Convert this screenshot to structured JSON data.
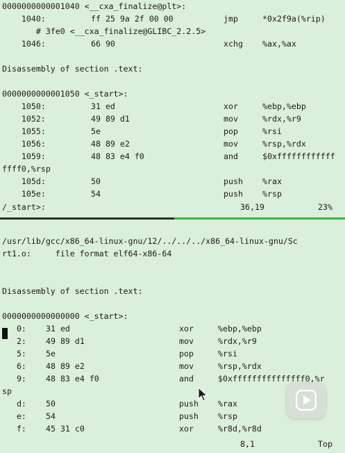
{
  "top_pane": {
    "lines": [
      {
        "segs": [
          "0000000000001040 <__cxa_finalize@plt>:"
        ]
      },
      {
        "segs": [
          "    1040:",
          "ff 25 9a 2f 00 00",
          "jmp",
          "*0x2f9a(%rip)"
        ]
      },
      {
        "segs": [
          "       # 3fe0 <__cxa_finalize@GLIBC_2.2.5>"
        ]
      },
      {
        "segs": [
          "    1046:",
          "66 90",
          "xchg",
          "%ax,%ax"
        ]
      },
      {
        "segs": [
          ""
        ]
      },
      {
        "segs": [
          "Disassembly of section .text:"
        ]
      },
      {
        "segs": [
          ""
        ]
      },
      {
        "segs": [
          "0000000000001050 <_start>:"
        ]
      },
      {
        "segs": [
          "    1050:",
          "31 ed",
          "xor",
          "%ebp,%ebp"
        ]
      },
      {
        "segs": [
          "    1052:",
          "49 89 d1",
          "mov",
          "%rdx,%r9"
        ]
      },
      {
        "segs": [
          "    1055:",
          "5e",
          "pop",
          "%rsi"
        ]
      },
      {
        "segs": [
          "    1056:",
          "48 89 e2",
          "mov",
          "%rsp,%rdx"
        ]
      },
      {
        "segs": [
          "    1059:",
          "48 83 e4 f0",
          "and",
          "$0xffffffffffff"
        ]
      },
      {
        "segs": [
          "ffff0,%rsp"
        ]
      },
      {
        "segs": [
          "    105d:",
          "50",
          "push",
          "%rax"
        ]
      },
      {
        "segs": [
          "    105e:",
          "54",
          "push",
          "%rsp"
        ]
      }
    ],
    "status": {
      "search": "/_start>:",
      "position": "36,19",
      "percent": "23%"
    }
  },
  "bottom_pane": {
    "lines": [
      {
        "segs": [
          ""
        ]
      },
      {
        "segs": [
          "/usr/lib/gcc/x86_64-linux-gnu/12/../../../x86_64-linux-gnu/Sc"
        ]
      },
      {
        "segs": [
          "rt1.o:     file format elf64-x86-64"
        ]
      },
      {
        "segs": [
          ""
        ]
      },
      {
        "segs": [
          ""
        ]
      },
      {
        "segs": [
          "Disassembly of section .text:"
        ]
      },
      {
        "segs": [
          ""
        ]
      },
      {
        "segs": [
          "0000000000000000 <_start>:"
        ]
      },
      {
        "segs": [
          "   0:",
          "31 ed",
          "xor",
          "%ebp,%ebp"
        ]
      },
      {
        "segs": [
          "   2:",
          "49 89 d1",
          "mov",
          "%rdx,%r9"
        ]
      },
      {
        "segs": [
          "   5:",
          "5e",
          "pop",
          "%rsi"
        ]
      },
      {
        "segs": [
          "   6:",
          "48 89 e2",
          "mov",
          "%rsp,%rdx"
        ]
      },
      {
        "segs": [
          "   9:",
          "48 83 e4 f0",
          "and",
          "$0xfffffffffffffff0,%r"
        ]
      },
      {
        "segs": [
          "sp"
        ]
      },
      {
        "segs": [
          "   d:",
          "50",
          "push",
          "%rax"
        ]
      },
      {
        "segs": [
          "   e:",
          "54",
          "push",
          "%rsp"
        ]
      },
      {
        "segs": [
          "   f:",
          "45 31 c0",
          "xor",
          "%r8d,%r8d"
        ]
      }
    ],
    "status": {
      "position": "8,1",
      "percent": "Top"
    }
  },
  "icons": {
    "text_cursor": "block-cursor",
    "mouse": "arrow-pointer-icon",
    "play": "play-icon"
  },
  "colors": {
    "background": "#daf0da",
    "text": "#1b1b1b",
    "split_active": "#3fb24a",
    "split_inactive": "#2b2b2b"
  }
}
